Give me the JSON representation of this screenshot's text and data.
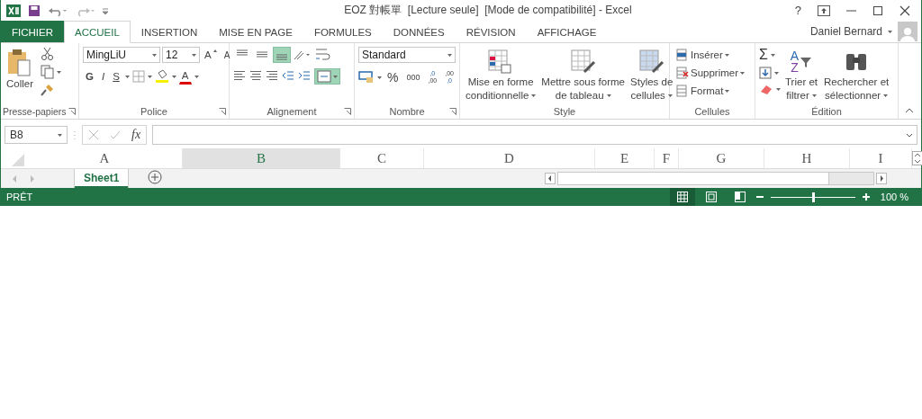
{
  "window": {
    "title": "EOZ 對帳單  [Lecture seule]  [Mode de compatibilité] - Excel",
    "help": "?"
  },
  "tabs": [
    {
      "label": "FICHIER",
      "kind": "file",
      "selected": false
    },
    {
      "label": "ACCUEIL",
      "kind": "tab",
      "selected": true
    },
    {
      "label": "INSERTION",
      "kind": "tab",
      "selected": false
    },
    {
      "label": "MISE EN PAGE",
      "kind": "tab",
      "selected": false
    },
    {
      "label": "FORMULES",
      "kind": "tab",
      "selected": false
    },
    {
      "label": "DONNÉES",
      "kind": "tab",
      "selected": false
    },
    {
      "label": "RÉVISION",
      "kind": "tab",
      "selected": false
    },
    {
      "label": "AFFICHAGE",
      "kind": "tab",
      "selected": false
    }
  ],
  "user": {
    "name": "Daniel Bernard"
  },
  "ribbon": {
    "clipboard": {
      "paste": "Coller",
      "label": "Presse-papiers"
    },
    "font": {
      "name": "MingLiU",
      "size": "12",
      "grow": "A",
      "shrink": "A",
      "bold": "G",
      "italic": "I",
      "underline": "S",
      "font_color": "A",
      "label": "Police"
    },
    "alignment": {
      "vertical": [
        {
          "selected": false
        },
        {
          "selected": false
        },
        {
          "selected": true
        }
      ],
      "merge": {
        "selected": true
      },
      "label": "Alignement"
    },
    "number": {
      "format": "Standard",
      "percent": "%",
      "thousands": "000",
      "increase": [
        ",0",
        ",00"
      ],
      "decrease": [
        ",00",
        ",0"
      ],
      "label": "Nombre"
    },
    "style": {
      "buttons": [
        [
          "Mise en forme",
          "conditionnelle"
        ],
        [
          "Mettre sous forme",
          "de tableau"
        ],
        [
          "Styles de",
          "cellules"
        ]
      ],
      "label": "Style"
    },
    "cells": {
      "buttons": [
        "Insérer",
        "Supprimer",
        "Format"
      ],
      "label": "Cellules"
    },
    "editing": {
      "sum": "Σ",
      "sort_letters": [
        "A",
        "Z"
      ],
      "sort": [
        "Trier et",
        "filtrer"
      ],
      "find": [
        "Rechercher et",
        "sélectionner"
      ],
      "label": "Édition"
    }
  },
  "formula_bar": {
    "name_box": "B8",
    "fx": "fx"
  },
  "columns": [
    {
      "label": "A",
      "selected": false
    },
    {
      "label": "B",
      "selected": true
    },
    {
      "label": "C",
      "selected": false
    },
    {
      "label": "D",
      "selected": false
    },
    {
      "label": "E",
      "selected": false
    },
    {
      "label": "F",
      "selected": false
    },
    {
      "label": "G",
      "selected": false
    },
    {
      "label": "H",
      "selected": false
    },
    {
      "label": "I",
      "selected": false
    }
  ],
  "sheets": [
    {
      "label": "Sheet1",
      "selected": true
    }
  ],
  "status_bar": {
    "ready": "PRÊT",
    "views": [
      {
        "selected": true
      },
      {
        "selected": false
      },
      {
        "selected": false
      }
    ],
    "zoom": {
      "level": 0.5,
      "reading": "100 %"
    }
  }
}
